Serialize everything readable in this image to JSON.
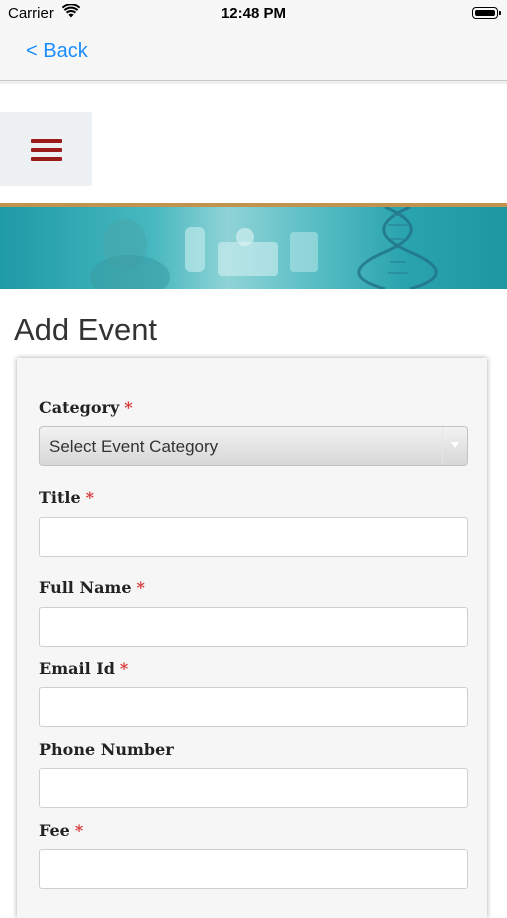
{
  "status_bar": {
    "carrier": "Carrier",
    "time": "12:48 PM"
  },
  "nav": {
    "back_label": "< Back"
  },
  "page": {
    "title": "Add Event"
  },
  "form": {
    "category": {
      "label": "Category",
      "required_mark": "*",
      "selected": "Select Event Category"
    },
    "title": {
      "label": "Title",
      "required_mark": "*"
    },
    "full_name": {
      "label": "Full Name",
      "required_mark": "*"
    },
    "email": {
      "label": "Email Id",
      "required_mark": "*"
    },
    "phone": {
      "label": "Phone Number"
    },
    "fee": {
      "label": "Fee",
      "required_mark": "*"
    }
  },
  "colors": {
    "link": "#1a8cff",
    "menu_icon": "#9b1a1a",
    "required": "#d63a3a",
    "banner": "#2aa4ae",
    "banner_border": "#c0934e"
  },
  "icons": {
    "wifi": "wifi-icon",
    "battery": "battery-icon",
    "menu": "hamburger-menu-icon",
    "select": "dropdown-arrow-icon"
  }
}
